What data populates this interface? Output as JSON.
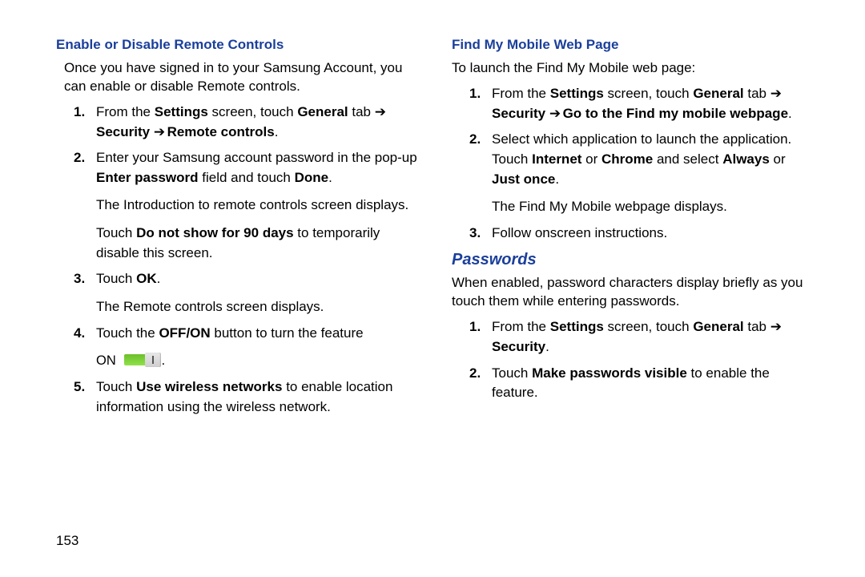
{
  "page_number": "153",
  "left": {
    "heading": "Enable or Disable Remote Controls",
    "intro": "Once you have signed in to your Samsung Account, you can enable or disable Remote controls.",
    "step1_prefix": "From the ",
    "step1_settings": "Settings",
    "step1_mid1": " screen, touch ",
    "step1_general": "General",
    "step1_tabword": " tab ",
    "step1_arrow1": "➔",
    "step1_security": "Security",
    "step1_arrow2": "➔",
    "step1_remote": "Remote controls",
    "step1_dot": ".",
    "step2_a": "Enter your Samsung account password in the pop-up ",
    "step2_ep": "Enter password",
    "step2_b": " field and touch ",
    "step2_done": "Done",
    "step2_dot": ".",
    "step2_sub1": "The Introduction to remote controls screen displays.",
    "step2_sub2a": "Touch ",
    "step2_sub2b": "Do not show for 90 days",
    "step2_sub2c": " to temporarily disable this screen.",
    "step3_a": "Touch ",
    "step3_ok": "OK",
    "step3_dot": ".",
    "step3_sub": "The Remote controls screen displays.",
    "step4_a": "Touch the ",
    "step4_offon": "OFF/ON",
    "step4_b": " button to turn the feature",
    "step4_on": "ON",
    "step5_a": "Touch ",
    "step5_label": "Use wireless networks",
    "step5_b": " to enable location information using the wireless network."
  },
  "right": {
    "heading1": "Find My Mobile Web Page",
    "intro1": "To launch the Find My Mobile web page:",
    "s1_prefix": "From the ",
    "s1_settings": "Settings",
    "s1_mid": " screen, touch ",
    "s1_general": "General",
    "s1_tab": " tab ",
    "s1_arrow1": "➔",
    "s1_security": "Security",
    "s1_arrow2": "➔",
    "s1_go": "Go to the Find my mobile webpage",
    "s1_dot": ".",
    "s2_a": "Select which application to launch the application. Touch ",
    "s2_internet": "Internet",
    "s2_or1": " or ",
    "s2_chrome": "Chrome",
    "s2_and": " and select ",
    "s2_always": "Always",
    "s2_or2": " or ",
    "s2_just": "Just once",
    "s2_dot": ".",
    "s2_sub": "The Find My Mobile webpage displays.",
    "s3": "Follow onscreen instructions.",
    "heading2": "Passwords",
    "intro2": "When enabled, password characters display briefly as you touch them while entering passwords.",
    "p1_prefix": "From the ",
    "p1_settings": "Settings",
    "p1_mid": " screen, touch ",
    "p1_general": "General",
    "p1_tab": " tab ",
    "p1_arrow": "➔",
    "p1_security": "Security",
    "p1_dot": ".",
    "p2_a": "Touch ",
    "p2_b": "Make passwords visible",
    "p2_c": " to enable the feature."
  }
}
